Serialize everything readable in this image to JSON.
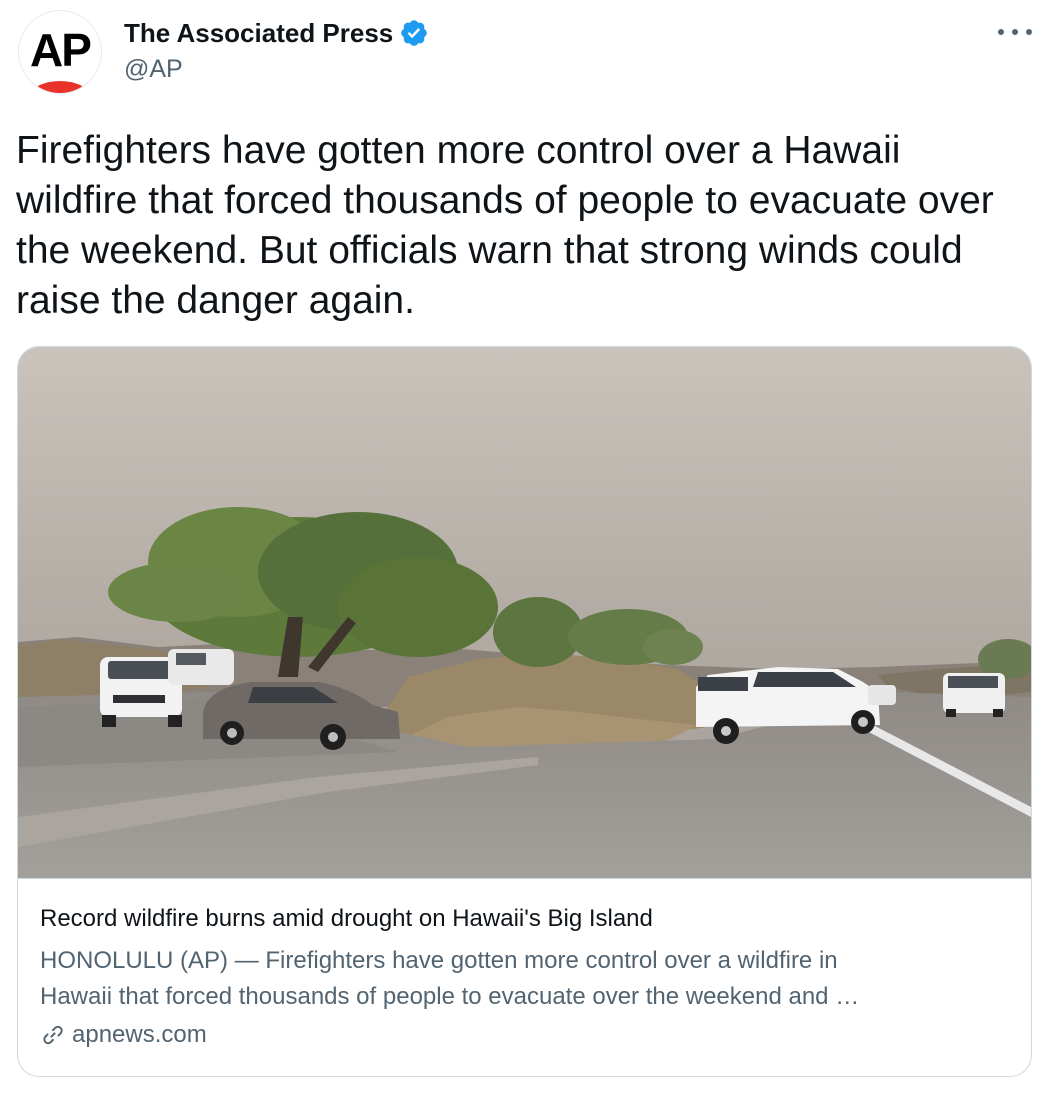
{
  "author": {
    "display_name": "The Associated Press",
    "handle": "@AP",
    "avatar_text": "AP",
    "verified": true
  },
  "tweet": {
    "text": "Firefighters have gotten more control over a Hawaii wildfire that forced thousands of people to evacuate over the weekend. But officials warn that strong winds could raise the danger again."
  },
  "card": {
    "title": "Record wildfire burns amid drought on Hawaii's Big Island",
    "description_line1": "HONOLULU (AP) — Firefighters have gotten more control over a wildfire in",
    "description_line2": "Hawaii that forced thousands of people to evacuate over the weekend and …",
    "domain": "apnews.com"
  },
  "colors": {
    "verified_blue": "#1d9bf0",
    "secondary_text": "#536471",
    "ap_red": "#e8322a"
  },
  "icons": {
    "more": "more-horizontal-icon",
    "verified": "verified-badge-icon",
    "link": "link-icon"
  }
}
